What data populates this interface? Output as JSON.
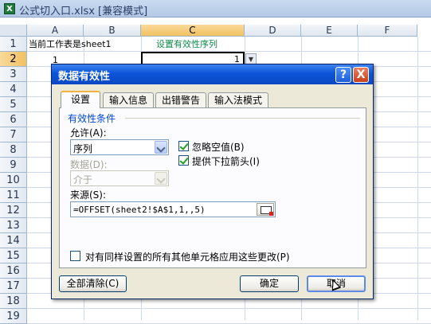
{
  "excel": {
    "title": "公式切入口.xlsx  [兼容模式]",
    "icon": "excel-icon",
    "columns": [
      "A",
      "B",
      "C",
      "D",
      "E",
      "F"
    ],
    "rows": [
      "1",
      "2",
      "3",
      "4",
      "5",
      "6",
      "7",
      "8",
      "9",
      "10",
      "11",
      "12",
      "13",
      "14",
      "15",
      "16",
      "17",
      "18",
      "19"
    ],
    "cells": {
      "a1": "当前工作表是sheet1",
      "c1": "设置有效性序列",
      "a2": "1",
      "c2": "1"
    },
    "accent_header": "#f1c15f",
    "c1_color": "#0d8a4a"
  },
  "dialog": {
    "title": "数据有效性",
    "help_label": "?",
    "close_label": "X",
    "tabs": [
      "设置",
      "输入信息",
      "出错警告",
      "输入法模式"
    ],
    "active_tab": "设置",
    "group_title": "有效性条件",
    "allow_label": "允许(A):",
    "allow_value": "序列",
    "data_label": "数据(D):",
    "data_value": "介于",
    "ignore_blank_label": "忽略空值(B)",
    "ignore_blank_checked": true,
    "dropdown_label": "提供下拉箭头(I)",
    "dropdown_checked": true,
    "source_label": "来源(S):",
    "source_value": "=OFFSET(sheet2!$A$1,1,,5)",
    "apply_all_label": "对有同样设置的所有其他单元格应用这些更改(P)",
    "apply_all_checked": false,
    "clear_all_label": "全部清除(C)",
    "ok_label": "确定",
    "cancel_label": "取消"
  }
}
